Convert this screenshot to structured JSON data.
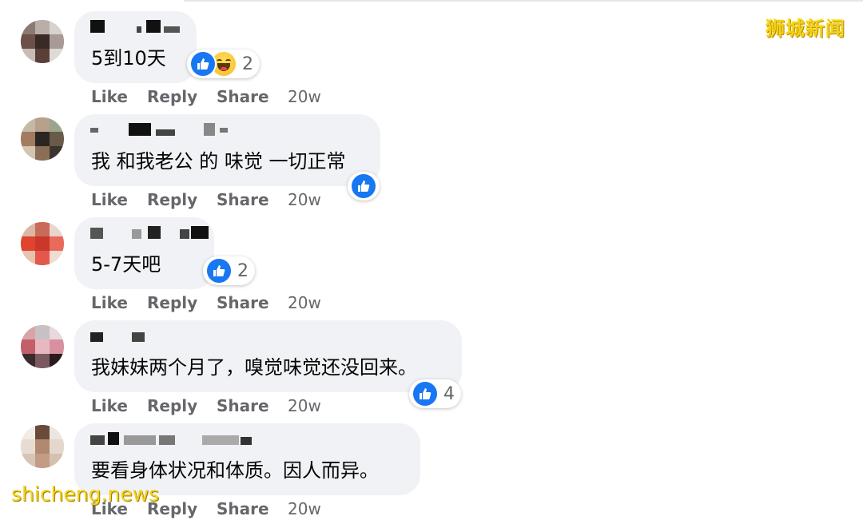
{
  "watermark": {
    "top": "狮城新闻",
    "bottom": "shicheng.news"
  },
  "colors": {
    "bubble": "#f0f2f5",
    "like_blue": "#1877f2",
    "haha_yellow": "#f7b928",
    "muted_text": "#65676b",
    "watermark": "#f2d21b"
  },
  "actions": {
    "like": "Like",
    "reply": "Reply",
    "share": "Share"
  },
  "comments": [
    {
      "author_redacted": true,
      "text": "5到10天",
      "reactions": [
        "like-icon",
        "haha-icon"
      ],
      "reaction_count": "2",
      "time": "20w"
    },
    {
      "author_redacted": true,
      "text": "我 和我老公 的 味觉 一切正常",
      "reactions": [
        "like-icon"
      ],
      "reaction_count": "",
      "time": "20w"
    },
    {
      "author_redacted": true,
      "text": "5-7天吧",
      "reactions": [
        "like-icon"
      ],
      "reaction_count": "2",
      "time": "20w"
    },
    {
      "author_redacted": true,
      "text": "我妹妹两个月了，嗅觉味觉还没回来。",
      "reactions": [
        "like-icon"
      ],
      "reaction_count": "4",
      "time": "20w"
    },
    {
      "author_redacted": true,
      "text": "要看身体状况和体质。因人而异。",
      "reactions": [],
      "reaction_count": "",
      "time": "20w"
    }
  ]
}
